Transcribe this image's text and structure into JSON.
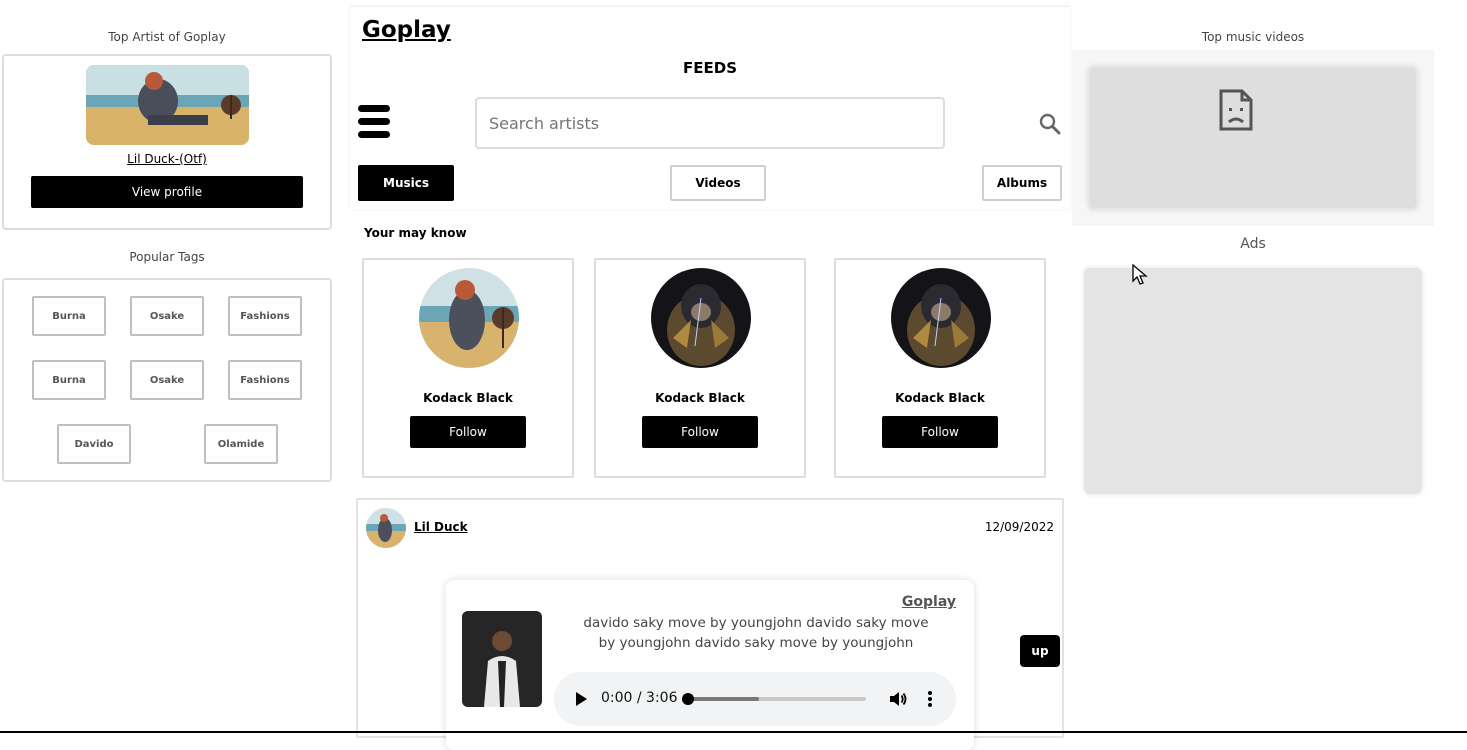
{
  "left": {
    "top_artist_title": "Top Artist of Goplay",
    "artist_name": "Lil Duck-(Otf)",
    "view_profile_label": "View profile",
    "popular_tags_title": "Popular Tags",
    "tags": [
      "Burna",
      "Osake",
      "Fashions",
      "Burna",
      "Osake",
      "Fashions",
      "Davido",
      "Olamide"
    ]
  },
  "header": {
    "brand": "Goplay",
    "feeds_title": "FEEDS",
    "search_placeholder": "Search artists",
    "tabs": {
      "musics": "Musics",
      "videos": "Videos",
      "albums": "Albums"
    }
  },
  "suggestions": {
    "title": "Your may know",
    "people": [
      {
        "name": "Kodack Black",
        "follow": "Follow"
      },
      {
        "name": "Kodack Black",
        "follow": "Follow"
      },
      {
        "name": "Kodack Black",
        "follow": "Follow"
      }
    ]
  },
  "post": {
    "author": "Lil Duck",
    "date": "12/09/2022",
    "player": {
      "brand": "Goplay",
      "description": "davido saky move by youngjohn davido saky move by youngjohn davido saky move by youngjohn",
      "time": "0:00 / 3:06",
      "progress_fraction": 0,
      "buffered_fraction": 0.4
    },
    "up_label": "up"
  },
  "right": {
    "top_videos_title": "Top music videos",
    "ads_title": "Ads"
  },
  "colors": {
    "accent": "#000000",
    "card_border": "#dcdcdc",
    "placeholder_bg": "#dedede"
  }
}
